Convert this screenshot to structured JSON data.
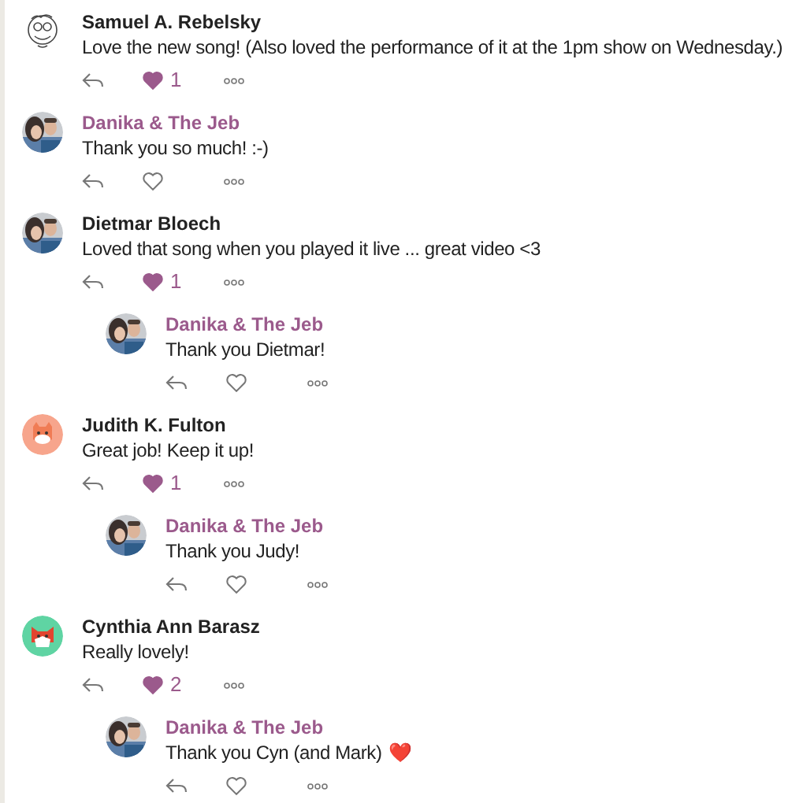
{
  "comments": [
    {
      "author": "Samuel A. Rebelsky",
      "artist": false,
      "avatar": {
        "kind": "doodle"
      },
      "text": "Love the new song!  (Also loved the performance of it at the 1pm show on Wednesday.)",
      "liked": true,
      "likes": "1"
    },
    {
      "author": "Danika & The Jeb",
      "artist": true,
      "text": "Thank you so much! :-)",
      "liked": false
    },
    {
      "author": "Dietmar Bloech",
      "artist": false,
      "text": "Loved that song when you played it live ... great video <3",
      "liked": true,
      "likes": "1",
      "replies": [
        {
          "author": "Danika & The Jeb",
          "artist": true,
          "text": "Thank you Dietmar!",
          "liked": false
        }
      ]
    },
    {
      "author": "Judith K. Fulton",
      "artist": false,
      "avatar": {
        "kind": "cat"
      },
      "text": "Great job!  Keep it up!",
      "liked": true,
      "likes": "1",
      "replies": [
        {
          "author": "Danika & The Jeb",
          "artist": true,
          "text": "Thank you Judy!",
          "liked": false
        }
      ]
    },
    {
      "author": "Cynthia Ann Barasz",
      "artist": false,
      "avatar": {
        "kind": "fox"
      },
      "text": "Really lovely!",
      "liked": true,
      "likes": "2",
      "replies": [
        {
          "author": "Danika & The Jeb",
          "artist": true,
          "text": "Thank you Cyn (and Mark)",
          "emoji": "❤️",
          "liked": false
        }
      ]
    }
  ]
}
